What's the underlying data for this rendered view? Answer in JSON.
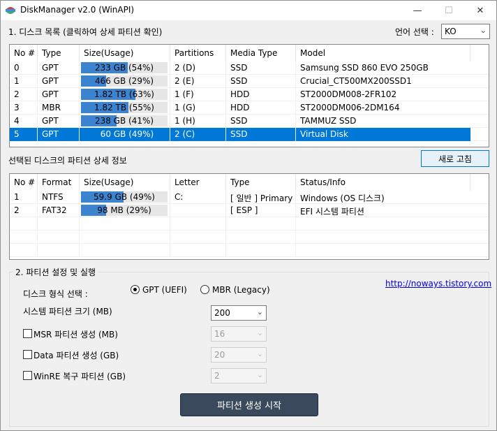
{
  "window": {
    "title": "DiskManager v2.0 (WinAPI)"
  },
  "header": {
    "disk_list_label": "1. 디스크 목록 (클릭하여 상세 파티션 확인)",
    "lang_label": "언어 선택 :",
    "lang_value": "KO"
  },
  "disk_list": {
    "columns": [
      "No #",
      "Type",
      "Size(Usage)",
      "Partitions",
      "Media Type",
      "Model"
    ],
    "rows": [
      {
        "no": "0",
        "type": "GPT",
        "size": "233 GB (54%)",
        "usage": 54,
        "partitions": "2 (D)",
        "media": "SSD",
        "model": "Samsung SSD 860 EVO 250GB",
        "selected": false
      },
      {
        "no": "1",
        "type": "GPT",
        "size": "466 GB (29%)",
        "usage": 29,
        "partitions": "2 (E)",
        "media": "SSD",
        "model": "Crucial_CT500MX200SSD1",
        "selected": false
      },
      {
        "no": "2",
        "type": "GPT",
        "size": "1.82 TB (63%)",
        "usage": 63,
        "partitions": "1 (F)",
        "media": "HDD",
        "model": "ST2000DM008-2FR102",
        "selected": false
      },
      {
        "no": "3",
        "type": "MBR",
        "size": "1.82 TB (55%)",
        "usage": 55,
        "partitions": "1 (G)",
        "media": "HDD",
        "model": "ST2000DM006-2DM164",
        "selected": false
      },
      {
        "no": "4",
        "type": "GPT",
        "size": "238 GB (41%)",
        "usage": 41,
        "partitions": "1 (H)",
        "media": "SSD",
        "model": "TAMMUZ SSD",
        "selected": false
      },
      {
        "no": "5",
        "type": "GPT",
        "size": "60 GB (49%)",
        "usage": 49,
        "partitions": "2 (C)",
        "media": "SSD",
        "model": "Virtual Disk",
        "selected": true
      }
    ]
  },
  "partition_detail": {
    "label": "선택된 디스크의 파티션 상세 정보",
    "refresh_label": "새로 고침",
    "columns": [
      "No #",
      "Format",
      "Size(Usage)",
      "Letter",
      "Type",
      "Status/Info"
    ],
    "rows": [
      {
        "no": "1",
        "format": "NTFS",
        "size": "59.9 GB (49%)",
        "usage": 49,
        "letter": "C:",
        "type": "[ 일반 ] Primary",
        "info": "Windows (OS 디스크)"
      },
      {
        "no": "2",
        "format": "FAT32",
        "size": "98 MB (29%)",
        "usage": 29,
        "letter": "",
        "type": "[ ESP ]",
        "info": "EFI 시스템 파티션"
      }
    ]
  },
  "settings": {
    "group_title": "2. 파티션 설정 및 실행",
    "disk_format_label": "디스크 형식 선택 :",
    "gpt_label": "GPT (UEFI)",
    "mbr_label": "MBR (Legacy)",
    "link": "http://noways.tistory.com",
    "sys_size_label": "시스템 파티션 크기 (MB)",
    "sys_size_value": "200",
    "msr_label": "MSR 파티션 생성 (MB)",
    "msr_value": "16",
    "data_label": "Data 파티션 생성 (GB)",
    "data_value": "20",
    "winre_label": "WinRE 복구 파티션 (GB)",
    "winre_value": "2",
    "start_label": "파티션 생성 시작"
  }
}
